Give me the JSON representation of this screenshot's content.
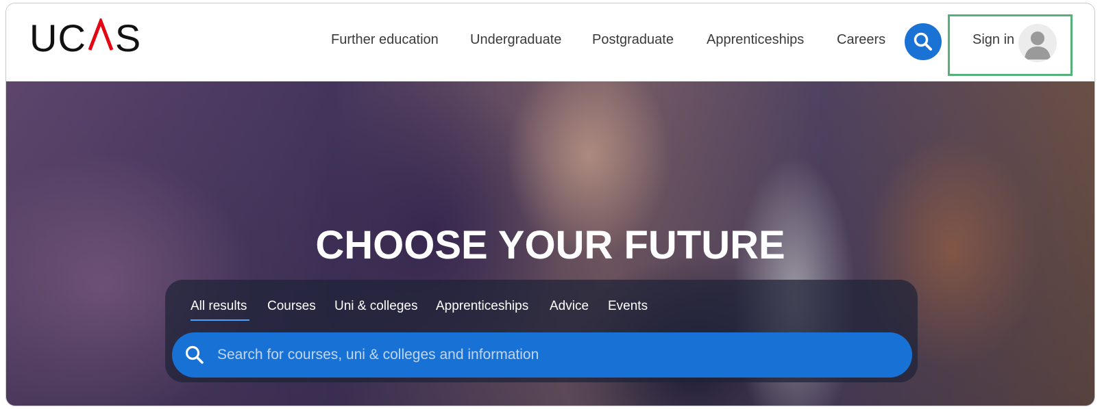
{
  "header": {
    "logo": {
      "letters_left": "UC",
      "letters_right": "S",
      "accent_color": "#e30613"
    },
    "nav": [
      {
        "label": "Further education"
      },
      {
        "label": "Undergraduate"
      },
      {
        "label": "Postgraduate"
      },
      {
        "label": "Apprenticeships"
      },
      {
        "label": "Careers"
      }
    ],
    "search_icon": "search-icon",
    "search_button_color": "#1a73d4",
    "sign_in": {
      "label": "Sign in",
      "icon": "user-avatar-icon"
    },
    "highlight_color": "#55b07a"
  },
  "hero": {
    "title": "CHOOSE YOUR FUTURE",
    "tabs": [
      {
        "label": "All results",
        "active": true
      },
      {
        "label": "Courses"
      },
      {
        "label": "Uni & colleges"
      },
      {
        "label": "Apprenticeships"
      },
      {
        "label": "Advice"
      },
      {
        "label": "Events"
      }
    ],
    "search": {
      "placeholder": "Search for courses, uni & colleges and information",
      "value": "",
      "icon": "search-icon"
    },
    "search_bar_color": "#1872d6"
  }
}
